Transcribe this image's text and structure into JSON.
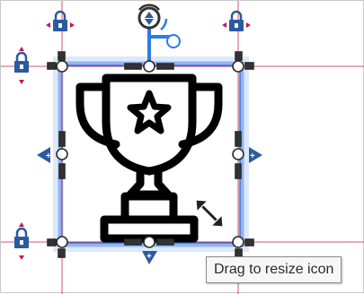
{
  "tooltip": {
    "text": "Drag to resize icon"
  },
  "canvas": {
    "icon": "trophy-star-icon",
    "guide_color": "#c2185b",
    "selection_color": "#5b8fe8",
    "handle_fill": "#ffffff",
    "lock_color": "#2b5a9e"
  }
}
